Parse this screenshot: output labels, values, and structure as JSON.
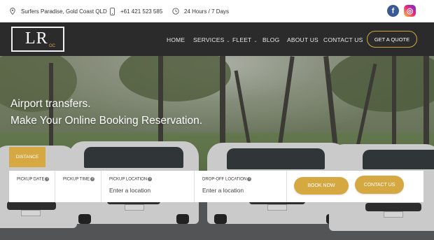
{
  "topbar": {
    "address": "Surfers Paradise, Gold Coast QLD",
    "phone": "+61 421 523 585",
    "hours": "24 Hours / 7 Days",
    "social": {
      "facebook_glyph": "f",
      "instagram_glyph": "◎"
    }
  },
  "logo": {
    "main": "LR",
    "sub": "OC"
  },
  "nav": {
    "items": [
      {
        "label": "HOME"
      },
      {
        "label": "SERVICES",
        "caret": "⌄"
      },
      {
        "label": "FLEET",
        "caret": "⌄"
      },
      {
        "label": "BLOG"
      },
      {
        "label": "ABOUT US"
      },
      {
        "label": "CONTACT US"
      }
    ],
    "cta": "GET A QUOTE"
  },
  "hero": {
    "headline_line1": "Airport transfers.",
    "headline_line2": "Make Your Online Booking Reservation."
  },
  "booking": {
    "tab": "DISTANCE",
    "help_glyph": "?",
    "fields": [
      {
        "label": "PICKUP DATE"
      },
      {
        "label": "PICKUP TIME"
      },
      {
        "label": "PICKUP LOCATION",
        "placeholder": "Enter a location"
      },
      {
        "label": "DROP-OFF LOCATION",
        "placeholder": "Enter a location"
      }
    ],
    "book_button": "BOOK NOW",
    "contact_button": "CONTACT US"
  },
  "colors": {
    "accent": "#d6a842",
    "nav_bg": "#2b2b2b"
  },
  "icons": [
    "map-pin-icon",
    "phone-icon",
    "clock-icon",
    "facebook-icon",
    "instagram-icon",
    "help-icon"
  ]
}
